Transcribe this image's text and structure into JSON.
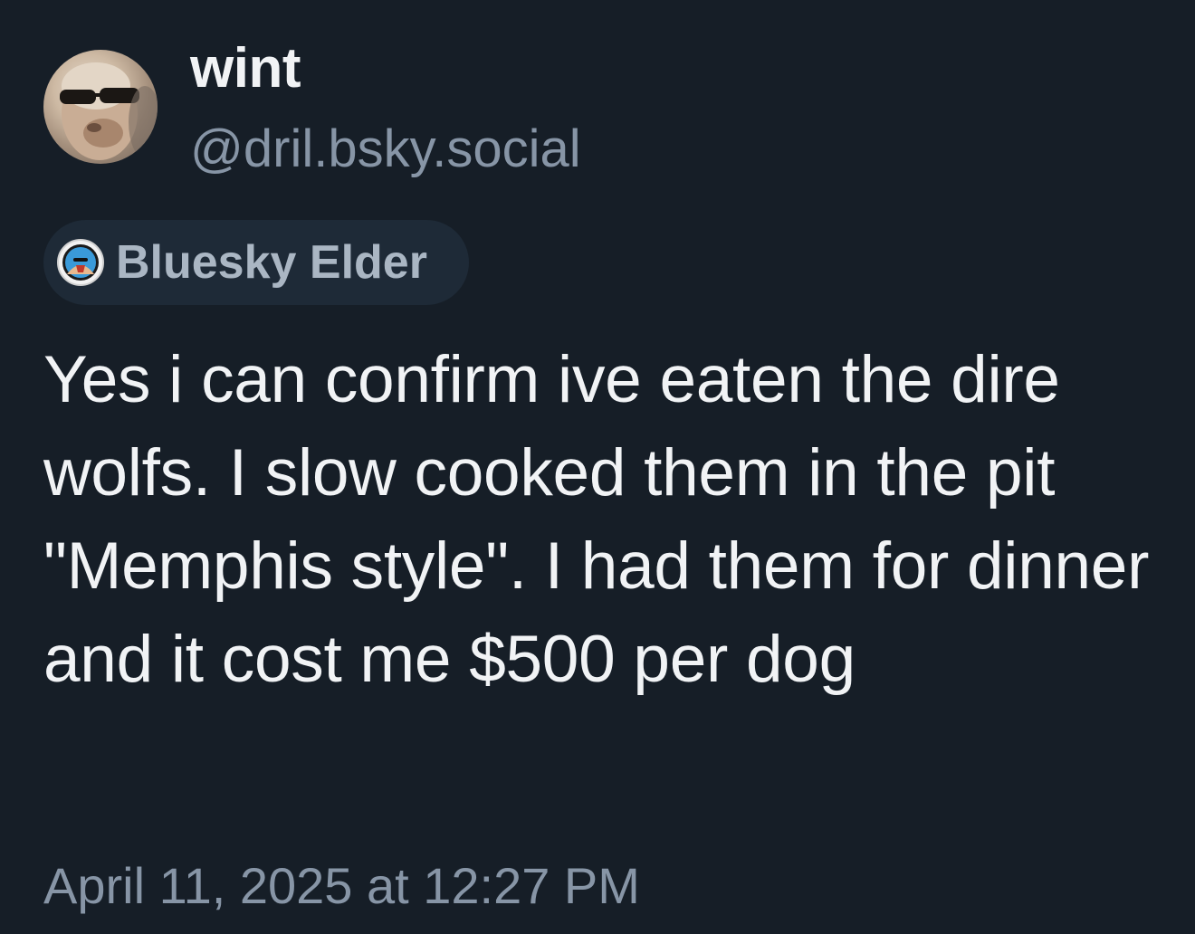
{
  "post": {
    "author": {
      "display_name": "wint",
      "handle": "@dril.bsky.social",
      "avatar_icon": "user-avatar"
    },
    "badge": {
      "label": "Bluesky Elder",
      "icon": "elder-badge-icon"
    },
    "text": "Yes i can confirm ive eaten the dire wolfs. I slow cooked them in the pit \"Memphis style\". I had them for dinner and it cost me $500 per dog",
    "timestamp": "April 11, 2025 at 12:27 PM"
  },
  "colors": {
    "background": "#161e27",
    "text_primary": "#f1f3f5",
    "text_secondary": "#8795a6",
    "badge_background": "#1e2a37",
    "badge_text": "#aab6c3"
  }
}
